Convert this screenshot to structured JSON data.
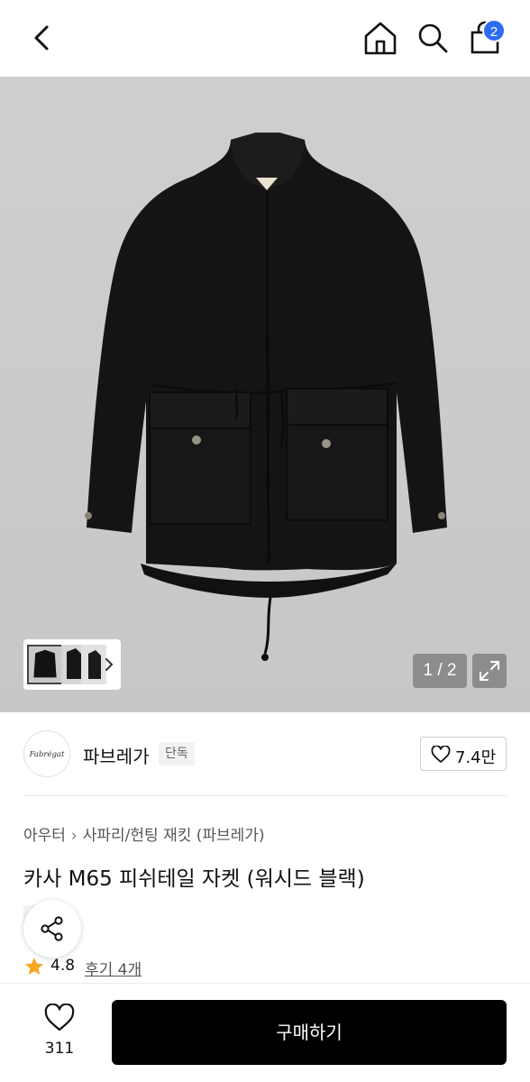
{
  "header": {
    "cart_count": "2",
    "icons": [
      "back-arrow-icon",
      "home-icon",
      "search-icon",
      "shopping-bag-icon"
    ]
  },
  "gallery": {
    "counter": "1 / 2",
    "background_color": "#c9c9cb"
  },
  "brand": {
    "logo_text": "Fabrégat",
    "name": "파브레가",
    "tag": "단독",
    "likes": "7.4만"
  },
  "product": {
    "breadcrumb": [
      "아우터",
      "사파리/헌팅 재킷 (파브레가)"
    ],
    "title": "카사 M65 피쉬테일 자켓 (워시드 블랙)",
    "tag": "단독",
    "rating": "4.8",
    "reviews": "후기 4개"
  },
  "bottom_bar": {
    "wish_count": "311",
    "buy_label": "구매하기",
    "buy_color": "#000000",
    "star_color": "#f5a623",
    "badge_color": "#2c6bf2"
  }
}
